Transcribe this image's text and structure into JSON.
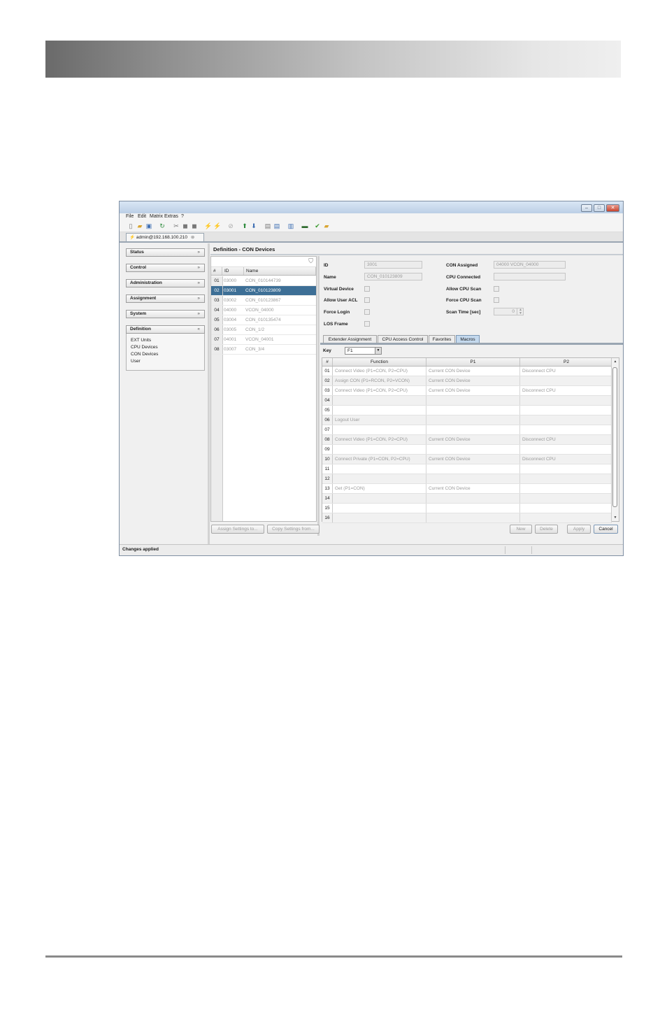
{
  "window": {
    "controls": [
      "–",
      "□",
      "✕"
    ]
  },
  "menu": [
    "File",
    "Edit",
    "Matrix",
    "Extras",
    "?"
  ],
  "toolbar_icons": [
    "new-icon",
    "open-icon",
    "save-icon",
    "refresh-icon",
    "cut-icon",
    "copy-icon",
    "paste-icon",
    "connect-icon",
    "disconnect-icon",
    "stop-icon",
    "upload-icon",
    "download-icon",
    "document-icon",
    "export-icon",
    "import-icon",
    "monitor-icon",
    "check-icon",
    "lock-icon"
  ],
  "session_tab": {
    "label": "admin@192.168.100.210"
  },
  "nav": {
    "groups": [
      {
        "label": "Status",
        "chevron": "»"
      },
      {
        "label": "Control",
        "chevron": "»"
      },
      {
        "label": "Administration",
        "chevron": "»"
      },
      {
        "label": "Assignment",
        "chevron": "»"
      },
      {
        "label": "System",
        "chevron": "»"
      },
      {
        "label": "Definition",
        "chevron": "«"
      }
    ],
    "definition_items": [
      "EXT Units",
      "CPU Devices",
      "CON Devices",
      "User"
    ]
  },
  "content": {
    "title": "Definition - CON Devices"
  },
  "list": {
    "headers": [
      "#",
      "ID",
      "Name"
    ],
    "rows": [
      {
        "num": "01",
        "id": "03000",
        "name": "CON_010144739"
      },
      {
        "num": "02",
        "id": "03001",
        "name": "CON_010123809",
        "selected": true
      },
      {
        "num": "03",
        "id": "03002",
        "name": "CON_010123867"
      },
      {
        "num": "04",
        "id": "04000",
        "name": "VCON_04000"
      },
      {
        "num": "05",
        "id": "03004",
        "name": "CON_010135474"
      },
      {
        "num": "06",
        "id": "03005",
        "name": "CON_1/2"
      },
      {
        "num": "07",
        "id": "04001",
        "name": "VCON_04001"
      },
      {
        "num": "08",
        "id": "03007",
        "name": "CON_3/4"
      }
    ]
  },
  "detail": {
    "id_label": "ID",
    "id_value": "3001",
    "name_label": "Name",
    "name_value": "CON_010123809",
    "virtual_device_label": "Virtual Device",
    "allow_user_acl_label": "Allow User ACL",
    "force_login_label": "Force Login",
    "los_frame_label": "LOS Frame",
    "con_assigned_label": "CON Assigned",
    "con_assigned_value": "04000  VCON_04000",
    "cpu_connected_label": "CPU Connected",
    "cpu_connected_value": "",
    "allow_cpu_scan_label": "Allow CPU Scan",
    "force_cpu_scan_label": "Force CPU Scan",
    "scan_time_label": "Scan Time [sec]",
    "scan_time_value": "0"
  },
  "detail_tabs": [
    "Extender Assignment",
    "CPU Access Control",
    "Favorites",
    "Macros"
  ],
  "macros": {
    "key_label": "Key",
    "key_value": "F1",
    "headers": [
      "#",
      "Function",
      "P1",
      "P2"
    ],
    "rows": [
      {
        "n": "01",
        "f": "Connect Video (P1=CON, P2=CPU)",
        "p1": "Current CON Device",
        "p2": "Disconnect CPU"
      },
      {
        "n": "02",
        "f": "Assign CON (P1=RCON, P2=VCON)",
        "p1": "Current CON Device",
        "p2": ""
      },
      {
        "n": "03",
        "f": "Connect Video (P1=CON, P2=CPU)",
        "p1": "Current CON Device",
        "p2": "Disconnect CPU"
      },
      {
        "n": "04",
        "f": "",
        "p1": "",
        "p2": ""
      },
      {
        "n": "05",
        "f": "",
        "p1": "",
        "p2": ""
      },
      {
        "n": "06",
        "f": "Logout User",
        "p1": "",
        "p2": ""
      },
      {
        "n": "07",
        "f": "",
        "p1": "",
        "p2": ""
      },
      {
        "n": "08",
        "f": "Connect Video (P1=CON, P2=CPU)",
        "p1": "Current CON Device",
        "p2": "Disconnect CPU"
      },
      {
        "n": "09",
        "f": "",
        "p1": "",
        "p2": ""
      },
      {
        "n": "10",
        "f": "Connect Private (P1=CON, P2=CPU)",
        "p1": "Current CON Device",
        "p2": "Disconnect CPU"
      },
      {
        "n": "11",
        "f": "",
        "p1": "",
        "p2": ""
      },
      {
        "n": "12",
        "f": "",
        "p1": "",
        "p2": ""
      },
      {
        "n": "13",
        "f": "Get (P1=CON)",
        "p1": "Current CON Device",
        "p2": ""
      },
      {
        "n": "14",
        "f": "",
        "p1": "",
        "p2": ""
      },
      {
        "n": "15",
        "f": "",
        "p1": "",
        "p2": ""
      },
      {
        "n": "16",
        "f": "",
        "p1": "",
        "p2": ""
      }
    ]
  },
  "buttons": {
    "assign_settings": "Assign Settings to...",
    "copy_settings": "Copy Settings from...",
    "new": "New",
    "delete": "Delete",
    "apply": "Apply",
    "cancel": "Cancel"
  },
  "status": {
    "text": "Changes applied"
  },
  "colors": {
    "selection": "#3d6f96",
    "active_tab": "#c4d9ee",
    "disabled_text": "#9a9a9a"
  }
}
